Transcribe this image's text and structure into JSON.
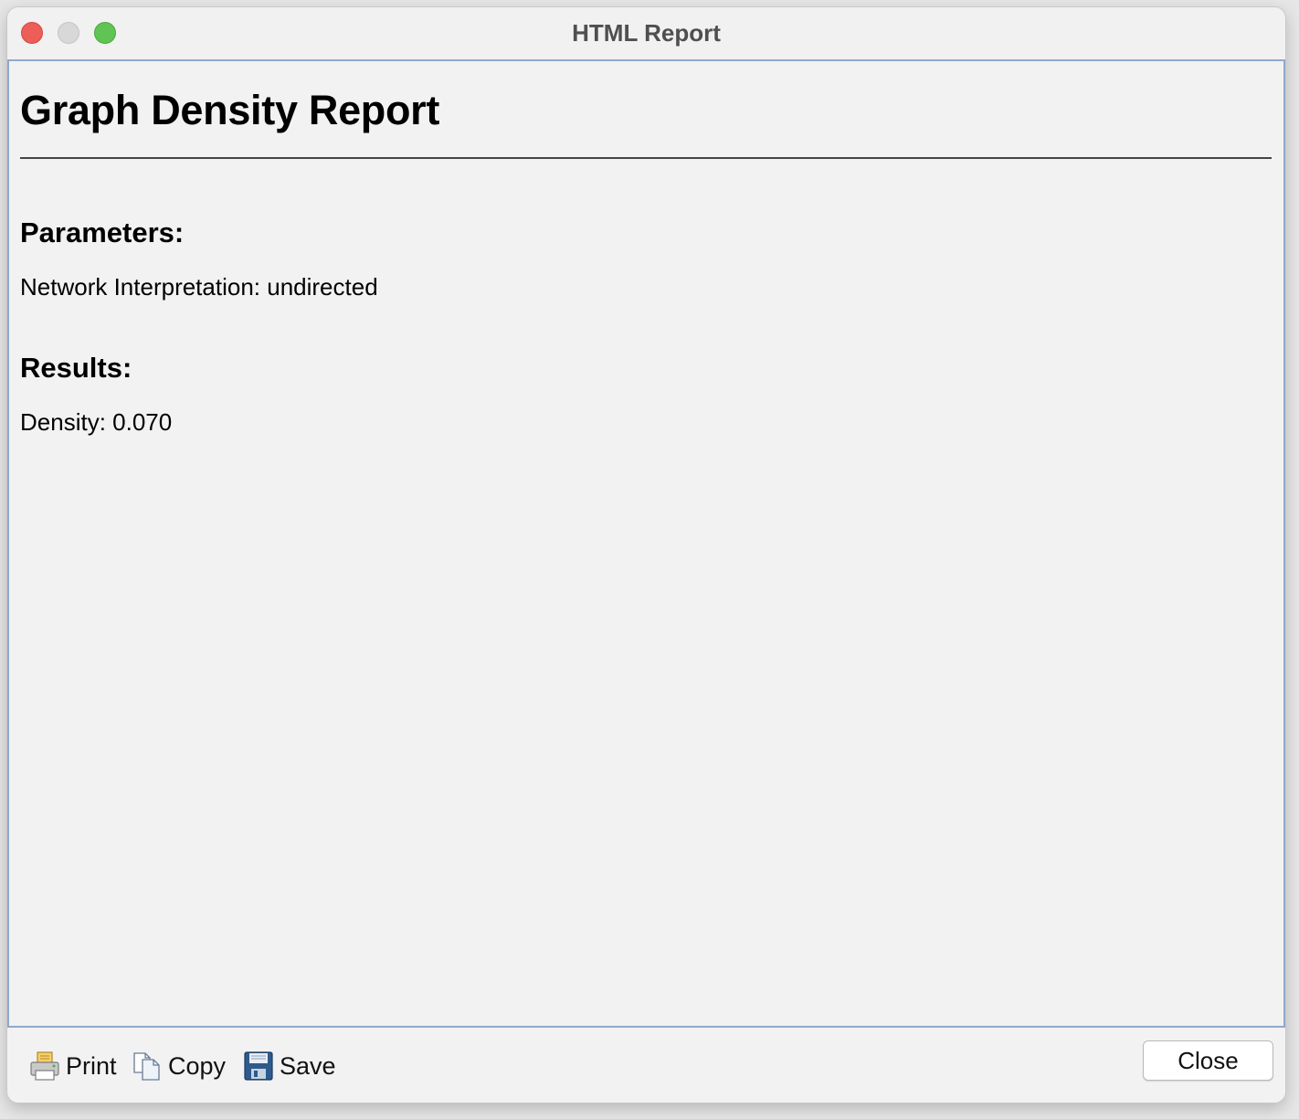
{
  "window": {
    "title": "HTML Report"
  },
  "report": {
    "title": "Graph Density Report",
    "parameters_heading": "Parameters:",
    "parameters_text": "Network Interpretation: undirected",
    "results_heading": "Results:",
    "results_text": "Density: 0.070"
  },
  "toolbar": {
    "print_label": "Print",
    "copy_label": "Copy",
    "save_label": "Save",
    "close_label": "Close",
    "print_icon": "printer-icon",
    "copy_icon": "copy-icon",
    "save_icon": "floppy-disk-icon"
  },
  "colors": {
    "traffic_close": "#ed5e59",
    "traffic_minimize": "#d8d8d8",
    "traffic_zoom": "#5fc453",
    "content_border": "#8fa9cc"
  }
}
